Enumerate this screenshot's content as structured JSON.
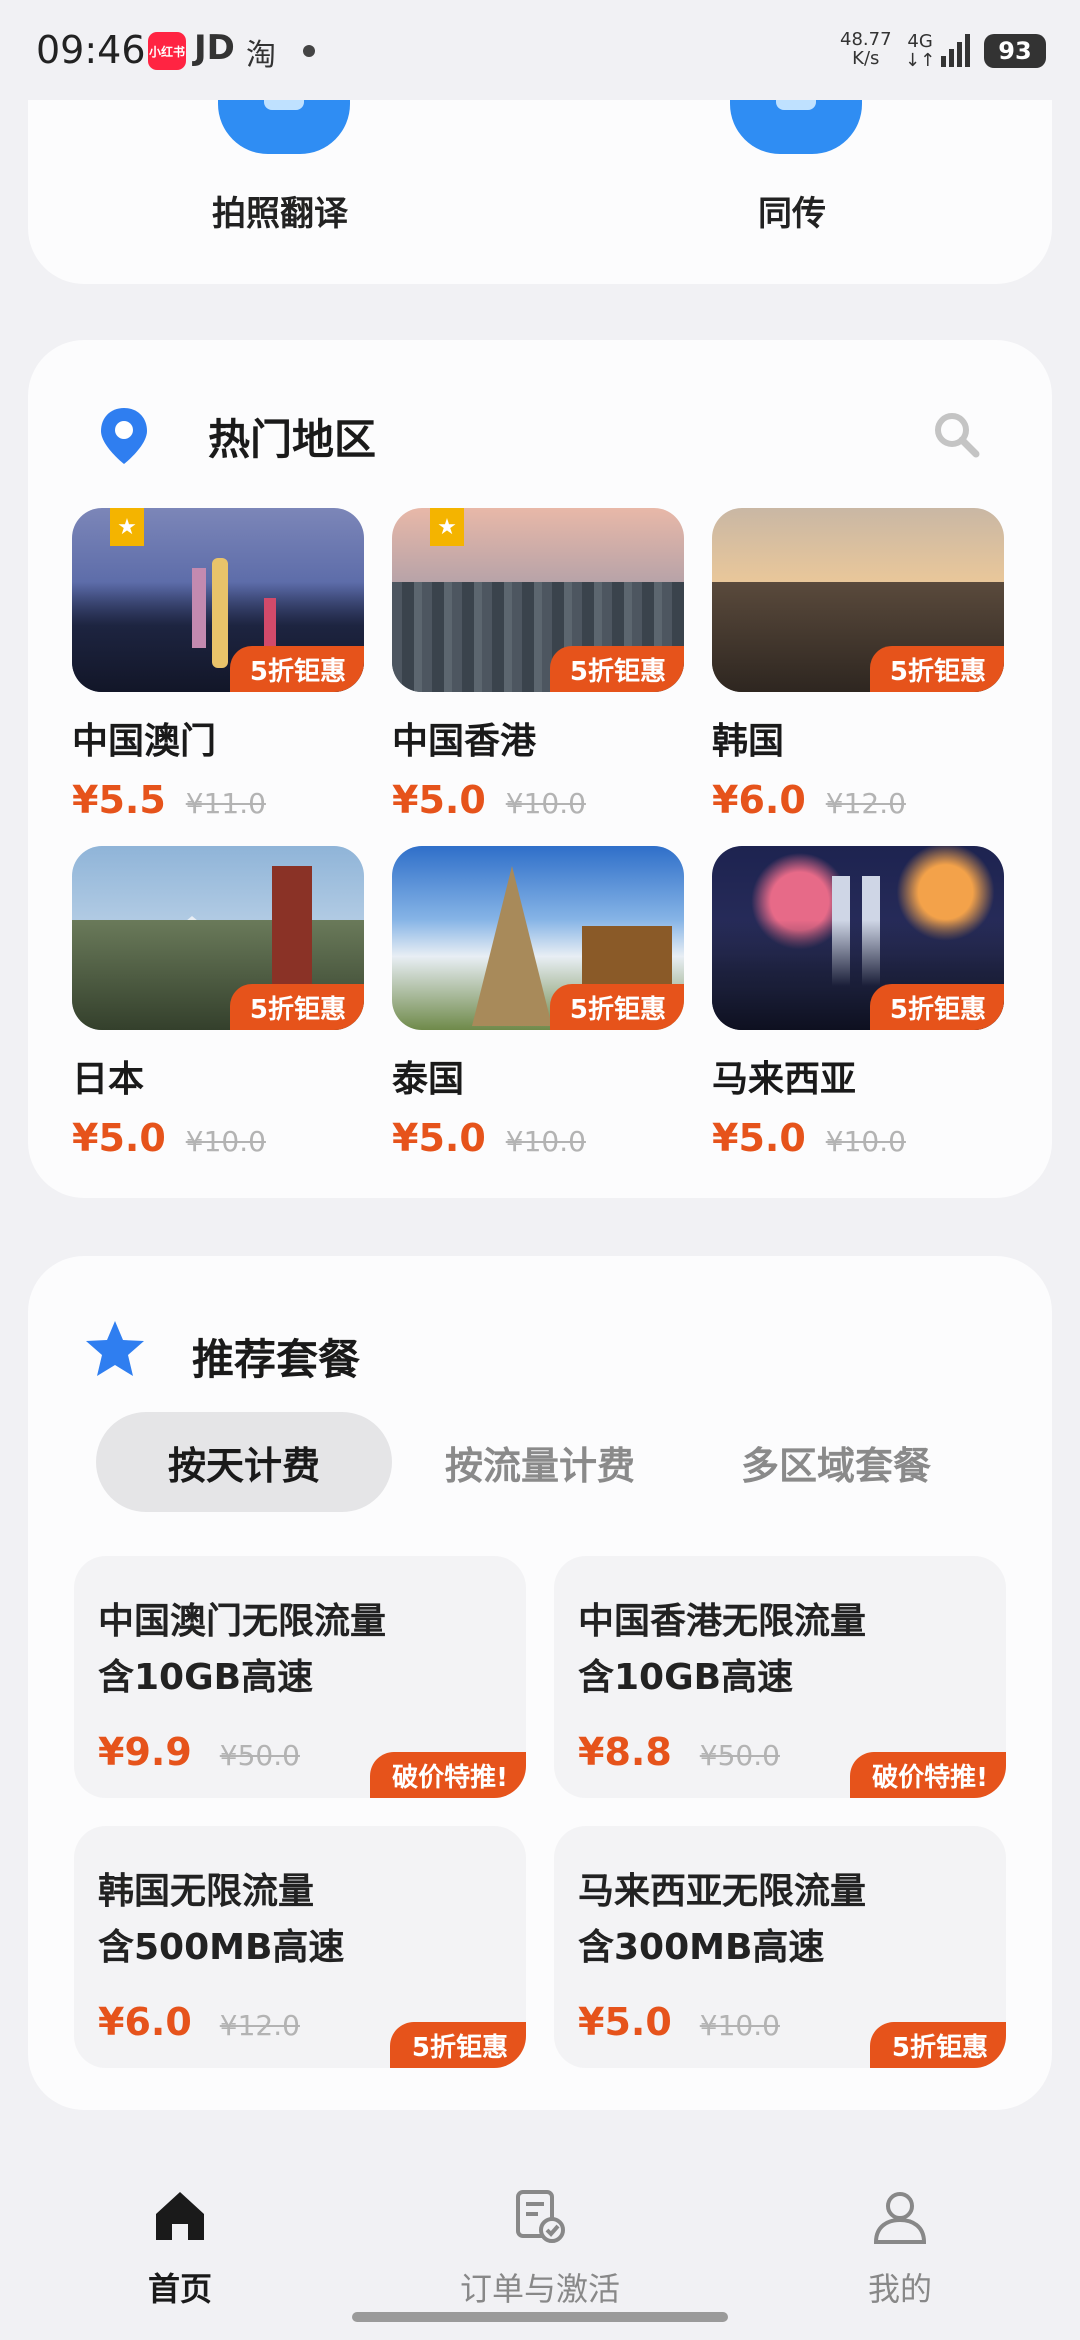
{
  "status_bar": {
    "time": "09:46",
    "app_xhs": "小红书",
    "app_jd": "JD",
    "app_taobao": "淘",
    "net_speed_value": "48.77",
    "net_speed_unit": "K/s",
    "net_type": "4G",
    "battery": "93"
  },
  "tools": [
    {
      "label": "拍照翻译",
      "icon": "photo-translate-icon"
    },
    {
      "label": "同传",
      "icon": "simultaneous-interpret-icon"
    }
  ],
  "hot_regions": {
    "title": "热门地区",
    "deal_label": "5折钜惠",
    "items": [
      {
        "name": "中国澳门",
        "price": "¥5.5",
        "orig": "¥11.0",
        "favorite": true
      },
      {
        "name": "中国香港",
        "price": "¥5.0",
        "orig": "¥10.0",
        "favorite": true
      },
      {
        "name": "韩国",
        "price": "¥6.0",
        "orig": "¥12.0",
        "favorite": false
      },
      {
        "name": "日本",
        "price": "¥5.0",
        "orig": "¥10.0",
        "favorite": false
      },
      {
        "name": "泰国",
        "price": "¥5.0",
        "orig": "¥10.0",
        "favorite": false
      },
      {
        "name": "马来西亚",
        "price": "¥5.0",
        "orig": "¥10.0",
        "favorite": false
      }
    ]
  },
  "recommended": {
    "title": "推荐套餐",
    "tabs": [
      "按天计费",
      "按流量计费",
      "多区域套餐"
    ],
    "active_tab": 0,
    "packages": [
      {
        "line1": "中国澳门无限流量",
        "line2": "含10GB高速",
        "price": "¥9.9",
        "orig": "¥50.0",
        "tag": "破价特推!"
      },
      {
        "line1": "中国香港无限流量",
        "line2": "含10GB高速",
        "price": "¥8.8",
        "orig": "¥50.0",
        "tag": "破价特推!"
      },
      {
        "line1": "韩国无限流量",
        "line2": "含500MB高速",
        "price": "¥6.0",
        "orig": "¥12.0",
        "tag": "5折钜惠"
      },
      {
        "line1": "马来西亚无限流量",
        "line2": "含300MB高速",
        "price": "¥5.0",
        "orig": "¥10.0",
        "tag": "5折钜惠"
      }
    ]
  },
  "bottom_nav": [
    {
      "label": "首页",
      "active": true
    },
    {
      "label": "订单与激活",
      "active": false
    },
    {
      "label": "我的",
      "active": false
    }
  ],
  "colors": {
    "accent": "#e6531b",
    "primary_blue": "#2f8df3",
    "favorite_gold": "#f4b400"
  }
}
